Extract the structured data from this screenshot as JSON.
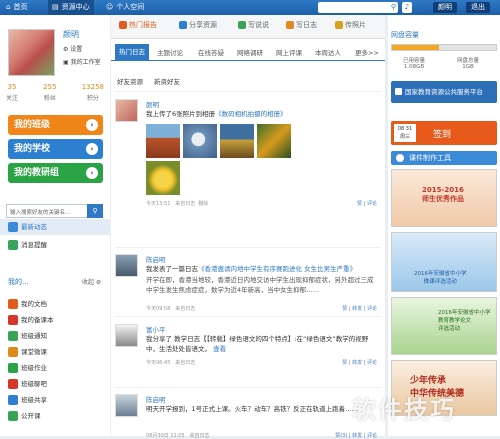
{
  "topbar": {
    "nav": [
      {
        "label": "首页",
        "icon": "home-icon"
      },
      {
        "label": "资源中心",
        "icon": "folder-icon"
      },
      {
        "label": "个人空间",
        "icon": "person-icon"
      }
    ],
    "user_label": "颜明",
    "logout_label": "退出"
  },
  "profile": {
    "name": "颜明",
    "links": [
      "设置",
      "我的工作室"
    ],
    "stats": [
      {
        "value": "35",
        "label": "关注"
      },
      {
        "value": "255",
        "label": "粉丝"
      },
      {
        "value": "13258",
        "label": "积分"
      }
    ]
  },
  "side_buttons": [
    {
      "label": "我的班级",
      "color": "#f08519"
    },
    {
      "label": "我的学校",
      "color": "#2d7fd1"
    },
    {
      "label": "我的教研组",
      "color": "#2aa344"
    }
  ],
  "left_search": {
    "placeholder": "输入搜索好友的关键名..."
  },
  "left_menu_top": [
    {
      "label": "最新动态",
      "color": "#3b8ad8"
    },
    {
      "label": "消息提醒",
      "color": "#3aa35a"
    }
  ],
  "my_modules": {
    "title": "我的...",
    "action": "收起"
  },
  "left_menu": [
    {
      "label": "我的文档",
      "color": "#e25c1f"
    },
    {
      "label": "我的备课本",
      "color": "#d9362b"
    },
    {
      "label": "班级通知",
      "color": "#3aa35a"
    },
    {
      "label": "课堂微课",
      "color": "#e08a1e"
    },
    {
      "label": "班级作业",
      "color": "#2aa344"
    },
    {
      "label": "班级聊吧",
      "color": "#d9362b"
    },
    {
      "label": "班级共享",
      "color": "#2d7fd1"
    },
    {
      "label": "公开课",
      "color": "#3aa35a"
    }
  ],
  "tabs_main": [
    {
      "label": "热门报告",
      "color": "#e25c1f",
      "active": true
    },
    {
      "label": "分享资源",
      "color": "#2d7fd1"
    },
    {
      "label": "写说说",
      "color": "#3aa35a"
    },
    {
      "label": "写日志",
      "color": "#e08a1e"
    },
    {
      "label": "传照片",
      "color": "#d9a21e"
    }
  ],
  "tabs_sub": [
    "热门日志",
    "主题讨论",
    "在线答疑",
    "网络调研",
    "网上评课",
    "本周达人",
    "更多>>"
  ],
  "sub_filters": [
    "好友资源",
    "新资好友"
  ],
  "posts": [
    {
      "author": "颜明",
      "text": "我上传了6张照片到相册",
      "link": "《数码相机拍摄的相册》",
      "meta": "今天13:51",
      "source": "来自日志",
      "del": "删除",
      "actions": "赞  |  评论",
      "pics": [
        "#b8532b",
        "#6d90b8",
        "#c8a13e",
        "#d69a1e",
        "#f0c12a"
      ]
    },
    {
      "author": "陈启明",
      "text": "我发表了一篇日志",
      "link": "《香港邀请内地中学生有序赛跑进化 女生比男生严重》",
      "body": "开学在即，香港当地较，香港近日内地交访中学生出现抑郁症状，另外超过三成中学生发生焦虑症症，数学为近4年新高，当中女生抑郁……",
      "meta": "今天09:58",
      "source": "来自日志",
      "actions": "赞  |  转发  |  评论"
    },
    {
      "author": "富小平",
      "text": "我分享了  教学日志【【转载】绿色语文的四个特点】:在“绿色语文”教学的视野中，生活处处皆语文。",
      "link": "查看",
      "meta": "今天06:45",
      "source": "来自日志",
      "actions": "赞  |  转发  |  评论"
    },
    {
      "author": "陈启明",
      "text": "明天开学报到，1号正式上课。火车？动车？高铁？反正在轨道上跑着……",
      "meta": "08月30日 22:05",
      "source": "来自日志",
      "actions": "赞(3)  |  转发  |  评论"
    }
  ],
  "storage": {
    "title": "网盘容量",
    "used_fraction": 0.45,
    "used_label": "已用容量",
    "used_value": "1.08GB",
    "total_label": "网盘总量",
    "total_value": "1GB"
  },
  "platform_banner": "国家教育资源公共服务平台",
  "signin": {
    "date": "08 31\n周三",
    "label": "签到"
  },
  "courseware_label": "课件制作工具",
  "ads": [
    {
      "text": "2015-2016\n师生优秀作品",
      "color": "#c3392b"
    },
    {
      "text": "2016年安徽省中小学\n微课评选活动",
      "color": "#3b8ad8"
    },
    {
      "text": "2016年安徽省中小学\n教育教学论文\n评选活动",
      "color": "#2aa344"
    },
    {
      "text": "少年传承\n中华传统美德",
      "color": "#b02a1f"
    }
  ],
  "watermark": "软件技巧"
}
